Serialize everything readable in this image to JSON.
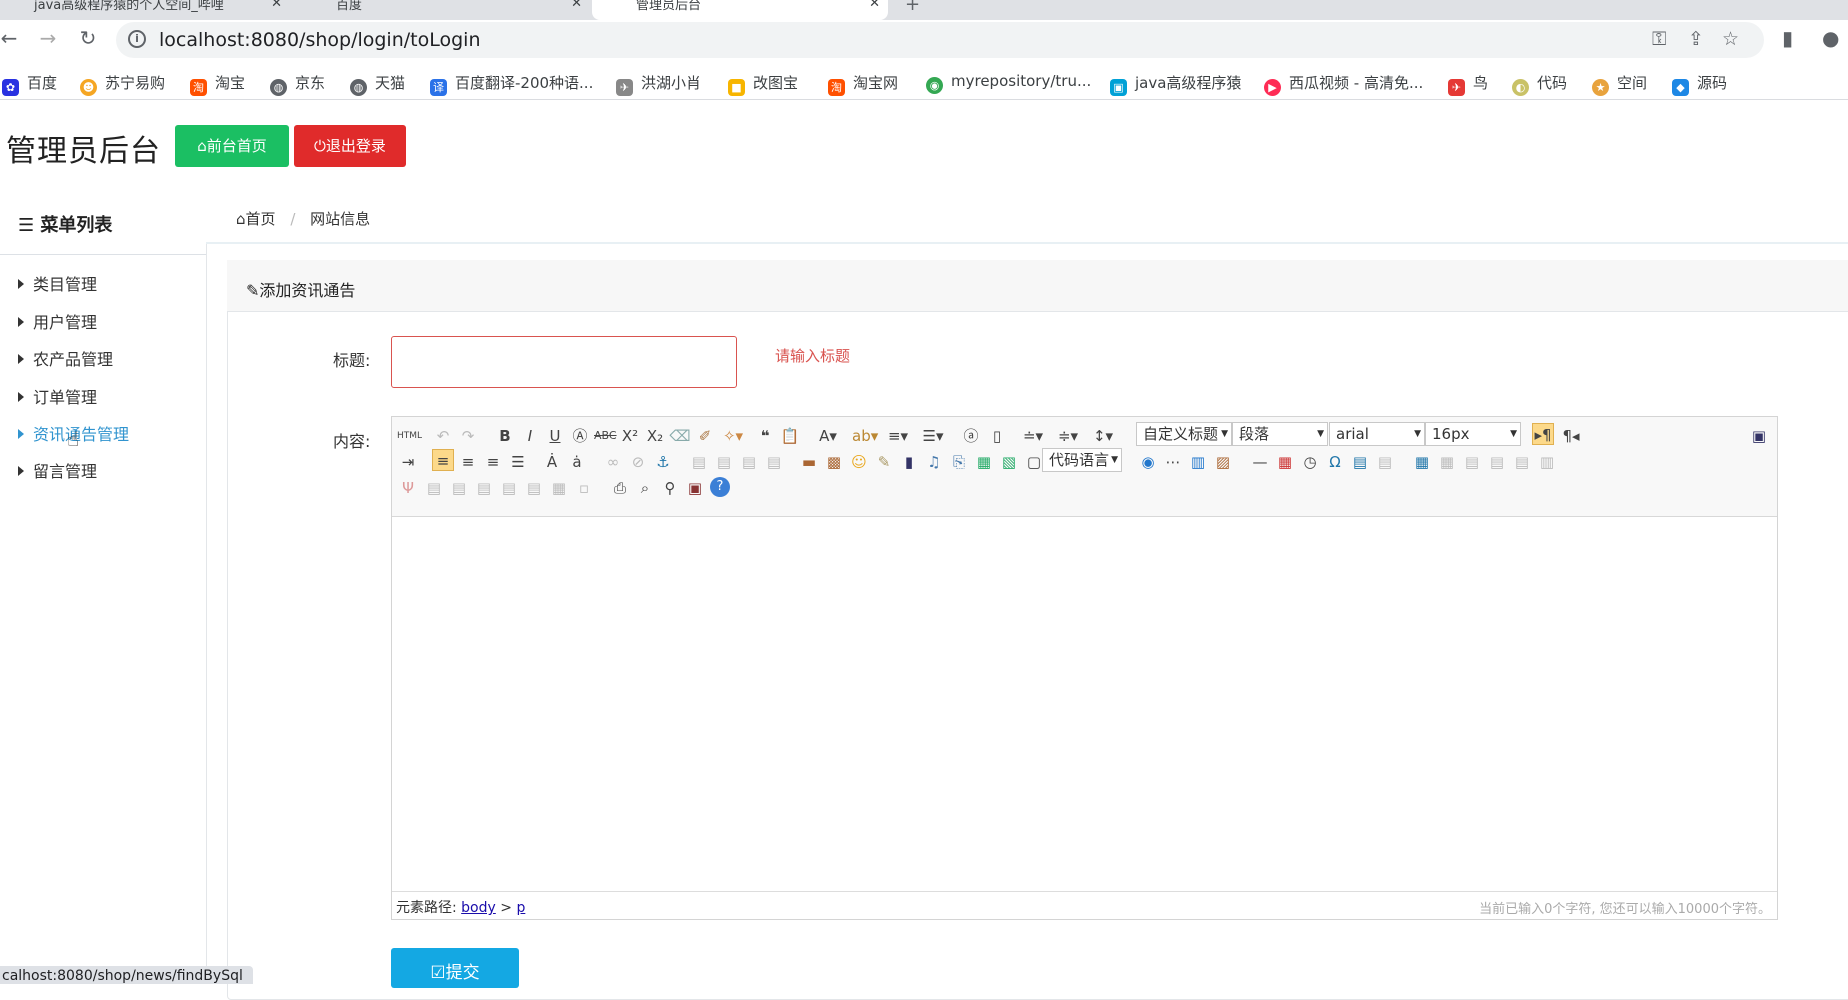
{
  "browser": {
    "tabs": [
      {
        "title": "java高级程序猿的个人空间_哔哩"
      },
      {
        "title": "百度"
      },
      {
        "title": "管理员后台"
      }
    ],
    "url": "localhost:8080/shop/login/toLogin",
    "bookmarks": [
      {
        "label": "百度",
        "icon": "baidu-icon",
        "color": "#2932e1"
      },
      {
        "label": "苏宁易购",
        "icon": "suning-icon",
        "color": "#f5a623"
      },
      {
        "label": "淘宝",
        "icon": "taobao-icon",
        "color": "#ff5000"
      },
      {
        "label": "京东",
        "icon": "globe-icon",
        "color": "#5f6368"
      },
      {
        "label": "天猫",
        "icon": "globe-icon",
        "color": "#5f6368"
      },
      {
        "label": "百度翻译-200种语...",
        "icon": "fanyi-icon",
        "color": "#2b72e8"
      },
      {
        "label": "洪湖小肖",
        "icon": "bird-icon",
        "color": "#888888"
      },
      {
        "label": "改图宝",
        "icon": "gaitubao-icon",
        "color": "#f7b500"
      },
      {
        "label": "淘宝网",
        "icon": "taobao-icon",
        "color": "#ff5000"
      },
      {
        "label": "myrepository/tru...",
        "icon": "chrome-icon",
        "color": "#34a853"
      },
      {
        "label": "java高级程序猿",
        "icon": "bilibili-icon",
        "color": "#00a1d6"
      },
      {
        "label": "西瓜视频 - 高清免...",
        "icon": "xigua-icon",
        "color": "#fe2c55"
      },
      {
        "label": "鸟",
        "icon": "bird-icon",
        "color": "#e53935"
      },
      {
        "label": "代码",
        "icon": "leaf-icon",
        "color": "#c9c267"
      },
      {
        "label": "空间",
        "icon": "star-icon",
        "color": "#e8a33d"
      },
      {
        "label": "源码",
        "icon": "fish-icon",
        "color": "#1e88e5"
      }
    ],
    "status_url": "calhost:8080/shop/news/findBySql"
  },
  "header": {
    "brand": "管理员后台",
    "home_button": "前台首页",
    "logout_button": "退出登录",
    "home_color": "#1bbf63",
    "logout_color": "#e02b2b"
  },
  "sidebar": {
    "title": "菜单列表",
    "items": [
      {
        "label": "类目管理"
      },
      {
        "label": "用户管理"
      },
      {
        "label": "农产品管理"
      },
      {
        "label": "订单管理"
      },
      {
        "label": "资讯通告管理",
        "active": true
      },
      {
        "label": "留言管理"
      }
    ]
  },
  "breadcrumb": {
    "home": "首页",
    "current": "网站信息"
  },
  "form": {
    "panel_title": "添加资讯通告",
    "title_label": "标题:",
    "title_value": "",
    "title_error": "请输入标题",
    "content_label": "内容:",
    "submit_label": "提交"
  },
  "editor": {
    "custom_heading": "自定义标题",
    "paragraph": "段落",
    "font_family": "arial",
    "font_size": "16px",
    "code_language": "代码语言",
    "element_path_label": "元素路径:",
    "path_body": "body",
    "path_sep": ">",
    "path_p": "p",
    "word_count": "当前已输入0个字符, 您还可以输入10000个字符。"
  }
}
